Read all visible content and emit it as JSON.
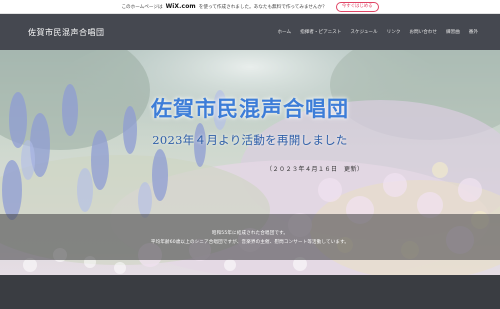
{
  "wix_banner": {
    "text_before": "このホームページは",
    "logo": "WiX.com",
    "text_after": "を使って作成されました。あなたも無料で作ってみませんか？",
    "cta": "今すぐはじめる",
    "accent_color": "#e04565"
  },
  "header": {
    "site_title": "佐賀市民混声合唱団",
    "nav": [
      "ホーム",
      "指揮者・ピアニスト",
      "スケジュール",
      "リンク",
      "お問い合わせ",
      "練習曲",
      "番外"
    ]
  },
  "hero": {
    "title": "佐賀市民混声合唱団",
    "subtitle": "2023年４月より活動を再開しました",
    "date_note": "（２０２３年４月１６日　更新）",
    "title_color": "#3d7dd8"
  },
  "info": {
    "line1": "昭和55年に結成された合唱団です。",
    "line2": "平均年齢60歳以上のシニア合唱団ですが、音楽界の主催、慰問コンサート等活動しています。"
  }
}
